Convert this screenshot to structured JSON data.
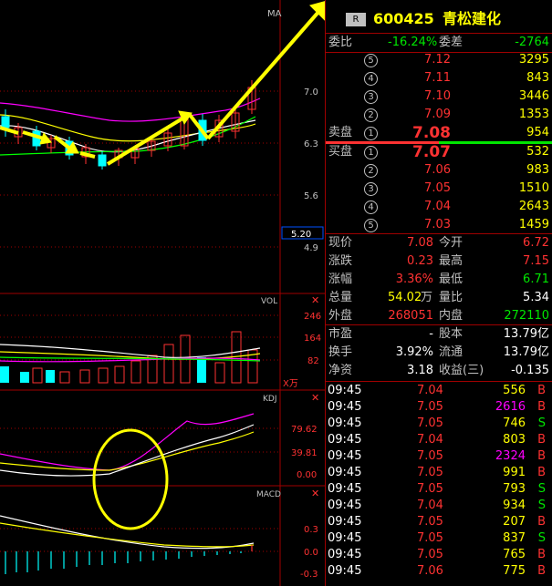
{
  "colors": {
    "up": "#ff3232",
    "down": "#00ffff",
    "ma_white": "#ffffff",
    "ma_yellow": "#ffff00",
    "ma_magenta": "#ff00ff",
    "ma_green": "#00ff00",
    "annotation": "#ffff00",
    "grid": "#a00000"
  },
  "chart": {
    "ma_label": "MA",
    "price_ticks": [
      "7.0",
      "6.3",
      "5.6",
      "4.9"
    ],
    "price_box": "5.20",
    "vol_label": "VOL",
    "vol_ticks": [
      "246",
      "164",
      "82"
    ],
    "vol_unit": "X万",
    "kdj_label": "KDJ",
    "kdj_ticks": [
      "79.62",
      "39.81",
      "0.00"
    ],
    "macd_label": "MACD",
    "macd_ticks": [
      "0.3",
      "0.0",
      "-0.3"
    ]
  },
  "header": {
    "badge": "R",
    "code": "600425",
    "name": "青松建化"
  },
  "weibi": {
    "label": "委比",
    "value": "-16.24%",
    "cha_label": "委差",
    "cha_value": "-2764"
  },
  "sell": {
    "label": "卖盘",
    "rows": [
      {
        "n": "5",
        "price": "7.12",
        "vol": "3295"
      },
      {
        "n": "4",
        "price": "7.11",
        "vol": "843"
      },
      {
        "n": "3",
        "price": "7.10",
        "vol": "3446"
      },
      {
        "n": "2",
        "price": "7.09",
        "vol": "1353"
      },
      {
        "n": "1",
        "price": "7.08",
        "vol": "954"
      }
    ]
  },
  "buy": {
    "label": "买盘",
    "rows": [
      {
        "n": "1",
        "price": "7.07",
        "vol": "532"
      },
      {
        "n": "2",
        "price": "7.06",
        "vol": "983"
      },
      {
        "n": "3",
        "price": "7.05",
        "vol": "1510"
      },
      {
        "n": "4",
        "price": "7.04",
        "vol": "2643"
      },
      {
        "n": "5",
        "price": "7.03",
        "vol": "1459"
      }
    ]
  },
  "quote": {
    "xianjia": {
      "label": "现价",
      "value": "7.08"
    },
    "jinkai": {
      "label": "今开",
      "value": "6.72"
    },
    "zhangdie": {
      "label": "涨跌",
      "value": "0.23"
    },
    "zuigao": {
      "label": "最高",
      "value": "7.15"
    },
    "zhangfu": {
      "label": "涨幅",
      "value": "3.36%"
    },
    "zuidi": {
      "label": "最低",
      "value": "6.71"
    },
    "zongliang": {
      "label": "总量",
      "value": "54.02",
      "unit": "万"
    },
    "liangbi": {
      "label": "量比",
      "value": "5.34"
    },
    "waipan": {
      "label": "外盘",
      "value": "268051"
    },
    "neipan": {
      "label": "内盘",
      "value": "272110"
    },
    "shiying": {
      "label": "市盈",
      "value": "-",
      "guben_label": "股本",
      "guben_value": "13.79亿"
    },
    "huanshou": {
      "label": "换手",
      "value": "3.92%",
      "liutong_label": "流通",
      "liutong_value": "13.79亿"
    },
    "jingzi": {
      "label": "净资",
      "value": "3.18",
      "shouyi_label": "收益(三)",
      "shouyi_value": "-0.135"
    }
  },
  "ticks": [
    {
      "time": "09:45",
      "price": "7.04",
      "vol": "556",
      "side": "B"
    },
    {
      "time": "09:45",
      "price": "7.05",
      "vol": "2616",
      "side": "B"
    },
    {
      "time": "09:45",
      "price": "7.05",
      "vol": "746",
      "side": "S"
    },
    {
      "time": "09:45",
      "price": "7.04",
      "vol": "803",
      "side": "B"
    },
    {
      "time": "09:45",
      "price": "7.05",
      "vol": "2324",
      "side": "B"
    },
    {
      "time": "09:45",
      "price": "7.05",
      "vol": "991",
      "side": "B"
    },
    {
      "time": "09:45",
      "price": "7.05",
      "vol": "793",
      "side": "S"
    },
    {
      "time": "09:45",
      "price": "7.04",
      "vol": "934",
      "side": "S"
    },
    {
      "time": "09:45",
      "price": "7.05",
      "vol": "207",
      "side": "B"
    },
    {
      "time": "09:45",
      "price": "7.05",
      "vol": "837",
      "side": "S"
    },
    {
      "time": "09:45",
      "price": "7.05",
      "vol": "765",
      "side": "B"
    },
    {
      "time": "09:45",
      "price": "7.06",
      "vol": "775",
      "side": "B"
    }
  ]
}
